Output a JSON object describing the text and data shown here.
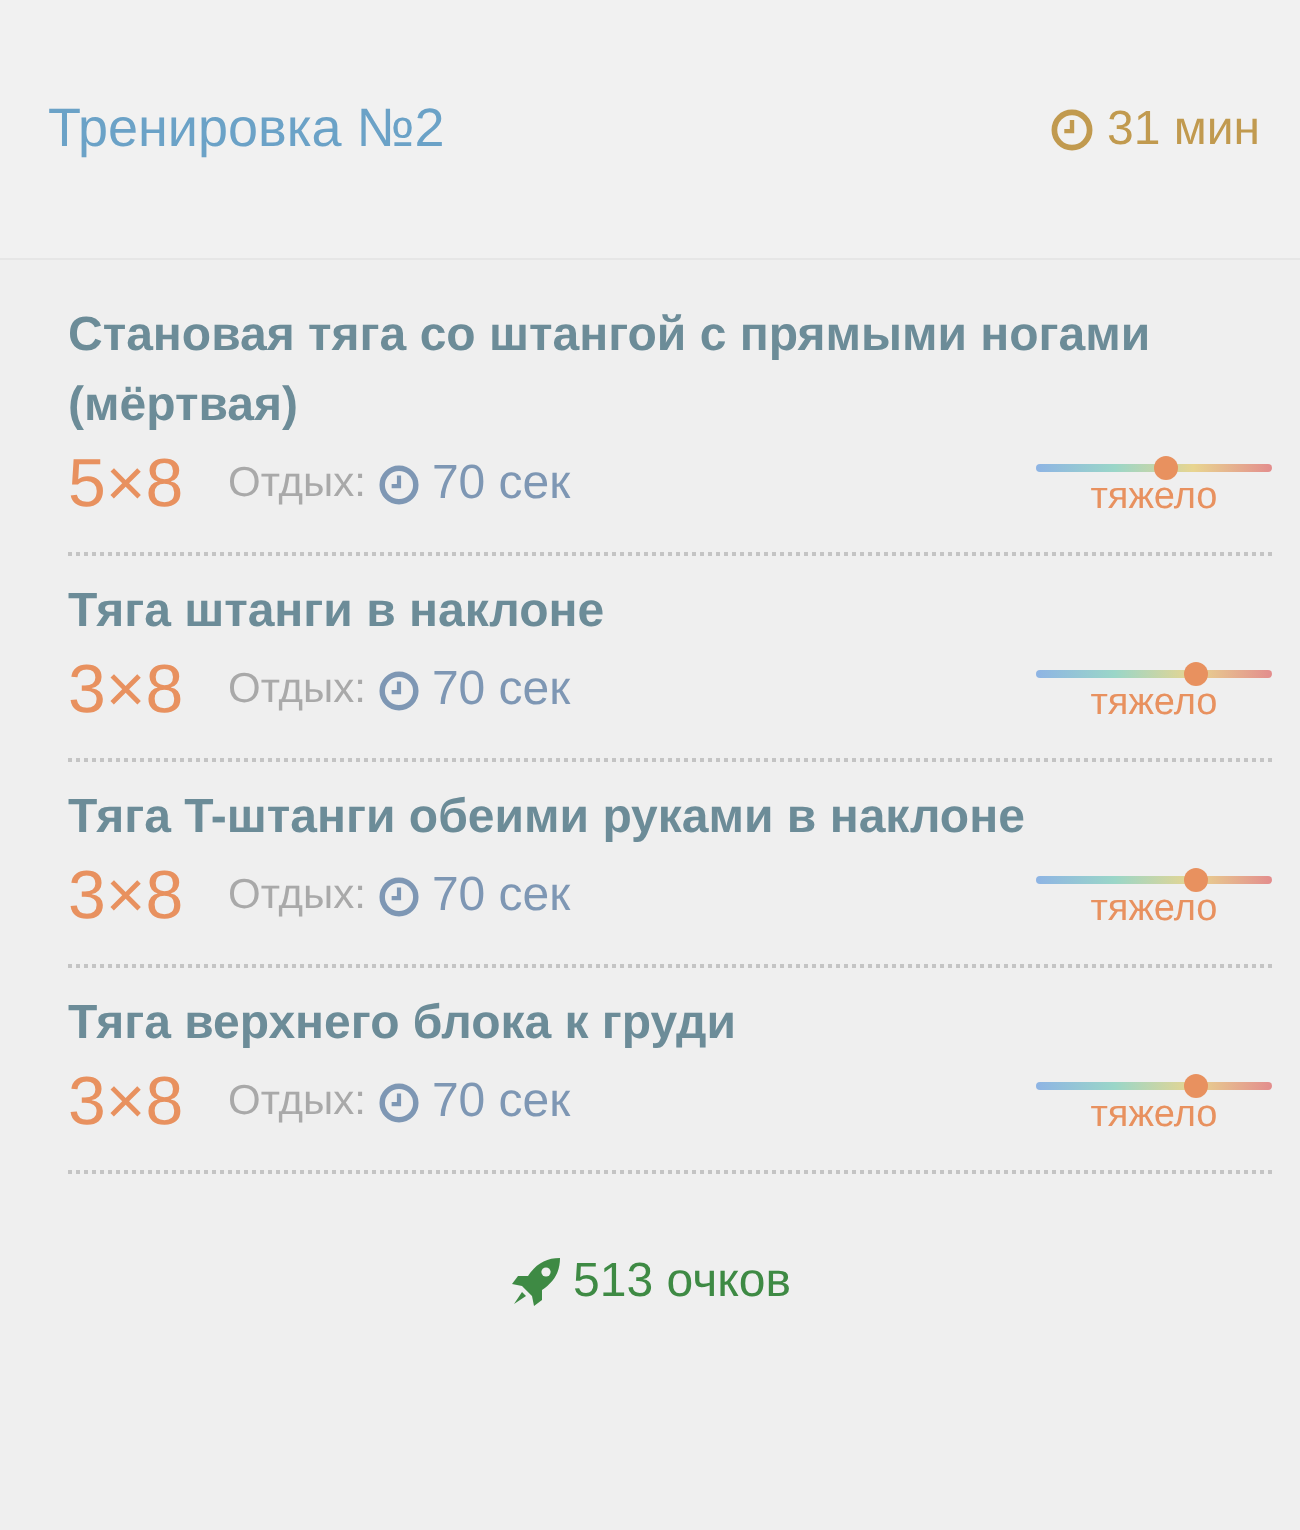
{
  "header": {
    "title": "Тренировка №2",
    "duration": "31 мин"
  },
  "exercises": [
    {
      "name": "Становая тяга со штангой с прямыми ногами (мёртвая)",
      "sets": "5×8",
      "rest_label": "Отдых:",
      "rest": "70 сек",
      "level": 0.55,
      "difficulty": "тяжело"
    },
    {
      "name": "Тяга штанги в наклоне",
      "sets": "3×8",
      "rest_label": "Отдых:",
      "rest": "70 сек",
      "level": 0.68,
      "difficulty": "тяжело"
    },
    {
      "name": "Тяга T-штанги обеими руками в наклоне",
      "sets": "3×8",
      "rest_label": "Отдых:",
      "rest": "70 сек",
      "level": 0.68,
      "difficulty": "тяжело"
    },
    {
      "name": "Тяга верхнего блока к груди",
      "sets": "3×8",
      "rest_label": "Отдых:",
      "rest": "70 сек",
      "level": 0.68,
      "difficulty": "тяжело"
    }
  ],
  "points": "513 очков"
}
